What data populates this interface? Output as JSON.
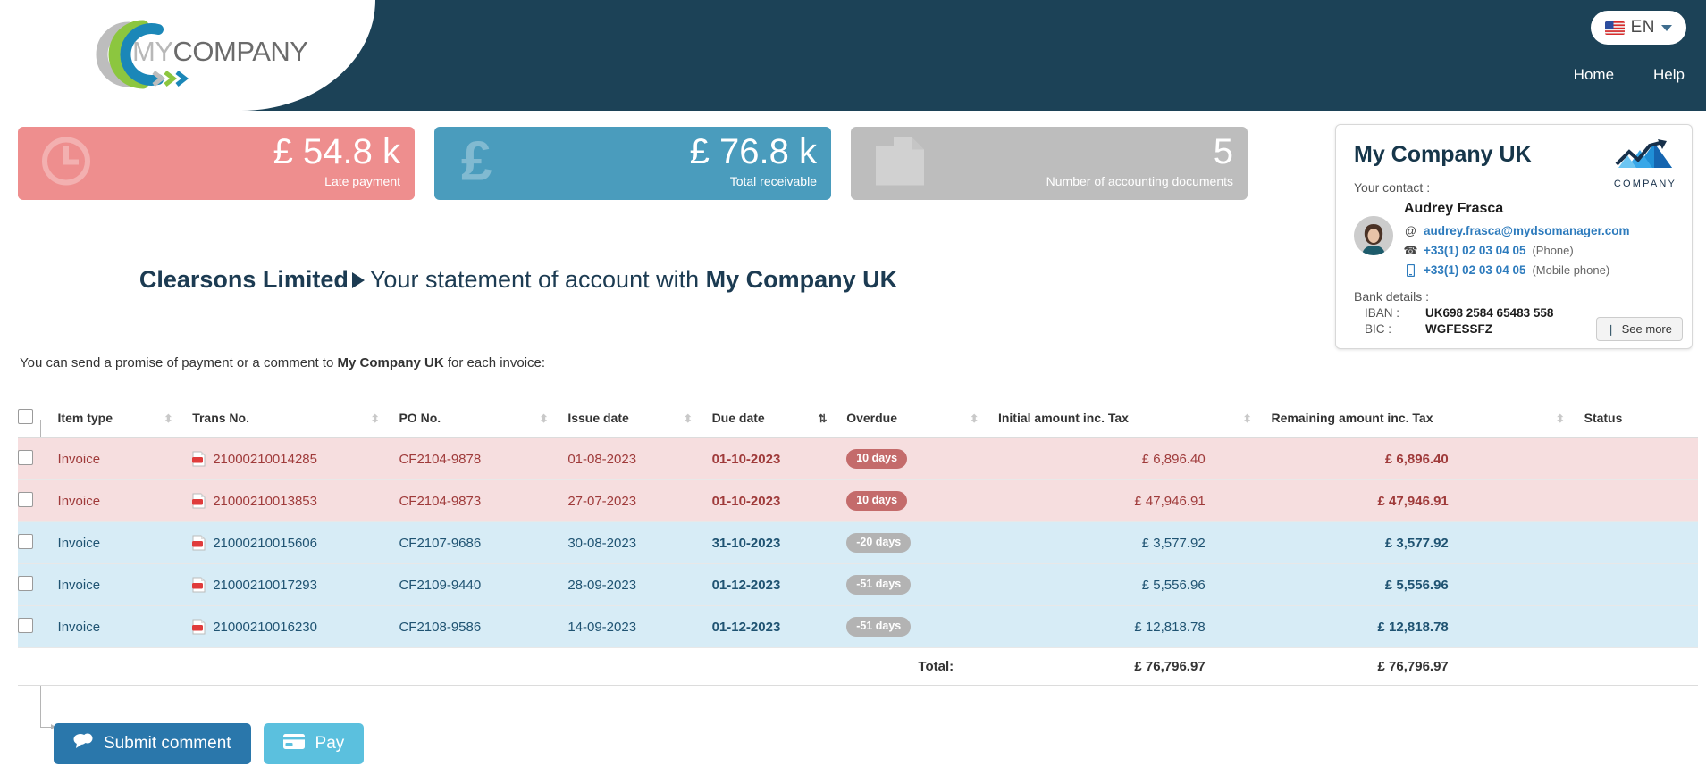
{
  "header": {
    "logo_text_my": "MY",
    "logo_text_company": "COMPANY",
    "language": {
      "code": "EN",
      "icon": "us-flag-icon"
    },
    "nav": [
      {
        "label": "Home"
      },
      {
        "label": "Help"
      }
    ]
  },
  "kpis": [
    {
      "value": "£ 54.8 k",
      "label": "Late payment",
      "icon": "clock-icon",
      "color": "#ee8e8e"
    },
    {
      "value": "£ 76.8 k",
      "label": "Total receivable",
      "icon": "pound-icon",
      "color": "#4a9cbd"
    },
    {
      "value": "5",
      "label": "Number of accounting documents",
      "icon": "documents-icon",
      "color": "#bdbdbd"
    }
  ],
  "contact_card": {
    "title": "My Company UK",
    "logo_word": "COMPANY",
    "contact_heading": "Your contact :",
    "name": "Audrey Frasca",
    "email": "audrey.frasca@mydsomanager.com",
    "phone": "+33(1) 02 03 04 05",
    "phone_note": "(Phone)",
    "mobile": "+33(1) 02 03 04 05",
    "mobile_note": "(Mobile phone)",
    "bank_heading": "Bank details :",
    "iban_key": "IBAN :",
    "iban_value": "UK698 2584 65483 558",
    "bic_key": "BIC :",
    "bic_value": "WGFESSFZ",
    "see_more_label": "See more"
  },
  "statement": {
    "customer": "Clearsons Limited",
    "middle": "Your statement of account with",
    "supplier": "My Company UK"
  },
  "promise": {
    "prefix": "You can send a promise of payment or a comment to ",
    "company": "My Company UK",
    "suffix": " for each invoice:"
  },
  "table": {
    "columns": [
      {
        "label": "Item type",
        "sortable": true,
        "sort_active": false
      },
      {
        "label": "Trans No.",
        "sortable": true,
        "sort_active": false
      },
      {
        "label": "PO No.",
        "sortable": true,
        "sort_active": false
      },
      {
        "label": "Issue date",
        "sortable": true,
        "sort_active": false
      },
      {
        "label": "Due date",
        "sortable": true,
        "sort_active": false
      },
      {
        "label": "Overdue",
        "sortable": true,
        "sort_active": true
      },
      {
        "label": "Initial amount inc. Tax",
        "sortable": true,
        "sort_active": false
      },
      {
        "label": "Remaining amount inc. Tax",
        "sortable": true,
        "sort_active": false
      },
      {
        "label": "Status",
        "sortable": true,
        "sort_active": false
      }
    ],
    "rows": [
      {
        "item_type": "Invoice",
        "trans_no": "21000210014285",
        "po_no": "CF2104-9878",
        "issue_date": "01-08-2023",
        "due_date": "01-10-2023",
        "overdue": "10 days",
        "overdue_state": "late",
        "initial_amount": "£ 6,896.40",
        "remaining_amount": "£ 6,896.40",
        "status": "",
        "state": "red"
      },
      {
        "item_type": "Invoice",
        "trans_no": "21000210013853",
        "po_no": "CF2104-9873",
        "issue_date": "27-07-2023",
        "due_date": "01-10-2023",
        "overdue": "10 days",
        "overdue_state": "late",
        "initial_amount": "£ 47,946.91",
        "remaining_amount": "£ 47,946.91",
        "status": "",
        "state": "red"
      },
      {
        "item_type": "Invoice",
        "trans_no": "21000210015606",
        "po_no": "CF2107-9686",
        "issue_date": "30-08-2023",
        "due_date": "31-10-2023",
        "overdue": "-20 days",
        "overdue_state": "notdue",
        "initial_amount": "£ 3,577.92",
        "remaining_amount": "£ 3,577.92",
        "status": "",
        "state": "blue"
      },
      {
        "item_type": "Invoice",
        "trans_no": "21000210017293",
        "po_no": "CF2109-9440",
        "issue_date": "28-09-2023",
        "due_date": "01-12-2023",
        "overdue": "-51 days",
        "overdue_state": "notdue",
        "initial_amount": "£ 5,556.96",
        "remaining_amount": "£ 5,556.96",
        "status": "",
        "state": "blue"
      },
      {
        "item_type": "Invoice",
        "trans_no": "21000210016230",
        "po_no": "CF2108-9586",
        "issue_date": "14-09-2023",
        "due_date": "01-12-2023",
        "overdue": "-51 days",
        "overdue_state": "notdue",
        "initial_amount": "£ 12,818.78",
        "remaining_amount": "£ 12,818.78",
        "status": "",
        "state": "blue"
      }
    ],
    "total": {
      "label": "Total:",
      "initial_amount": "£ 76,796.97",
      "remaining_amount": "£ 76,796.97"
    }
  },
  "actions": [
    {
      "label": "Submit comment",
      "icon": "comment-icon",
      "color": "#2a77ab"
    },
    {
      "label": "Pay",
      "icon": "credit-card-icon",
      "color": "#5bc0de"
    }
  ]
}
